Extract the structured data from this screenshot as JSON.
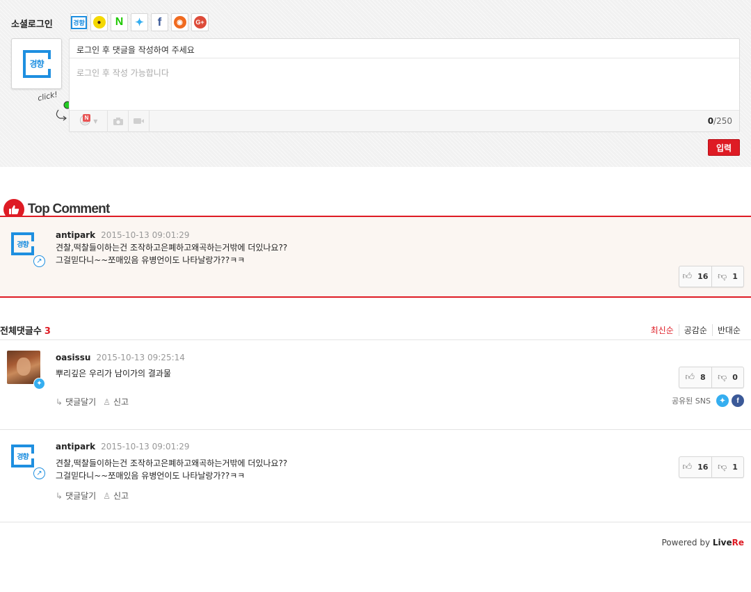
{
  "login": {
    "title": "소셜로그인",
    "providers": [
      {
        "name": "kyunghyang",
        "glyph": "경향",
        "color": "#1e8fe0"
      },
      {
        "name": "kakao",
        "glyph": "●",
        "color": "#f4d800"
      },
      {
        "name": "naver",
        "glyph": "N",
        "color": "#1ec800"
      },
      {
        "name": "twitter",
        "glyph": "✦",
        "color": "#35aef0"
      },
      {
        "name": "facebook",
        "glyph": "f",
        "color": "#3b5998"
      },
      {
        "name": "weibo",
        "glyph": "◉",
        "color": "#f06a1f"
      },
      {
        "name": "google-plus",
        "glyph": "G+",
        "color": "#dd4b39"
      }
    ]
  },
  "avatar": {
    "logo_text": "경향"
  },
  "mascot": {
    "click_label": "click!"
  },
  "editor": {
    "notice": "로그인 후 댓글을 작성하여 주세요",
    "placeholder": "로그인 후 작성 가능합니다",
    "count": "0",
    "max": "/250",
    "n_badge": "N"
  },
  "submit_label": "입력",
  "top_comment": {
    "title": "Top Comment",
    "comment": {
      "author": "antipark",
      "date": "2015-10-13 09:01:29",
      "lines": [
        "견찰,떡찰들이하는건 조작하고은폐하고왜곡하는거밖에 더있나요??",
        "그걸믿다니~~쪼매있음 유병언이도 나타날랑가??ㅋㅋ"
      ],
      "likes": "16",
      "dislikes": "1"
    }
  },
  "list": {
    "total_label": "전체댓글수",
    "total_count": "3",
    "sorts": [
      "최신순",
      "공감순",
      "반대순"
    ]
  },
  "comments": [
    {
      "author": "oasissu",
      "date": "2015-10-13 09:25:14",
      "lines": [
        "뿌리깊은 우리가 남이가의 결과물"
      ],
      "likes": "8",
      "dislikes": "0",
      "reply": "댓글달기",
      "report": "신고",
      "shared_label": "공유된 SNS"
    },
    {
      "author": "antipark",
      "date": "2015-10-13 09:01:29",
      "lines": [
        "견찰,떡찰들이하는건 조작하고은폐하고왜곡하는거밖에 더있나요??",
        "그걸믿다니~~쪼매있음 유병언이도 나타날랑가??ㅋㅋ"
      ],
      "likes": "16",
      "dislikes": "1",
      "reply": "댓글달기",
      "report": "신고"
    }
  ],
  "powered": {
    "prefix": "Powered by ",
    "brand_a": "Live",
    "brand_b": "Re"
  },
  "colors": {
    "accent": "#de1b24",
    "brand_blue": "#1e8fe0",
    "twitter": "#35aef0",
    "facebook": "#3b5998"
  }
}
